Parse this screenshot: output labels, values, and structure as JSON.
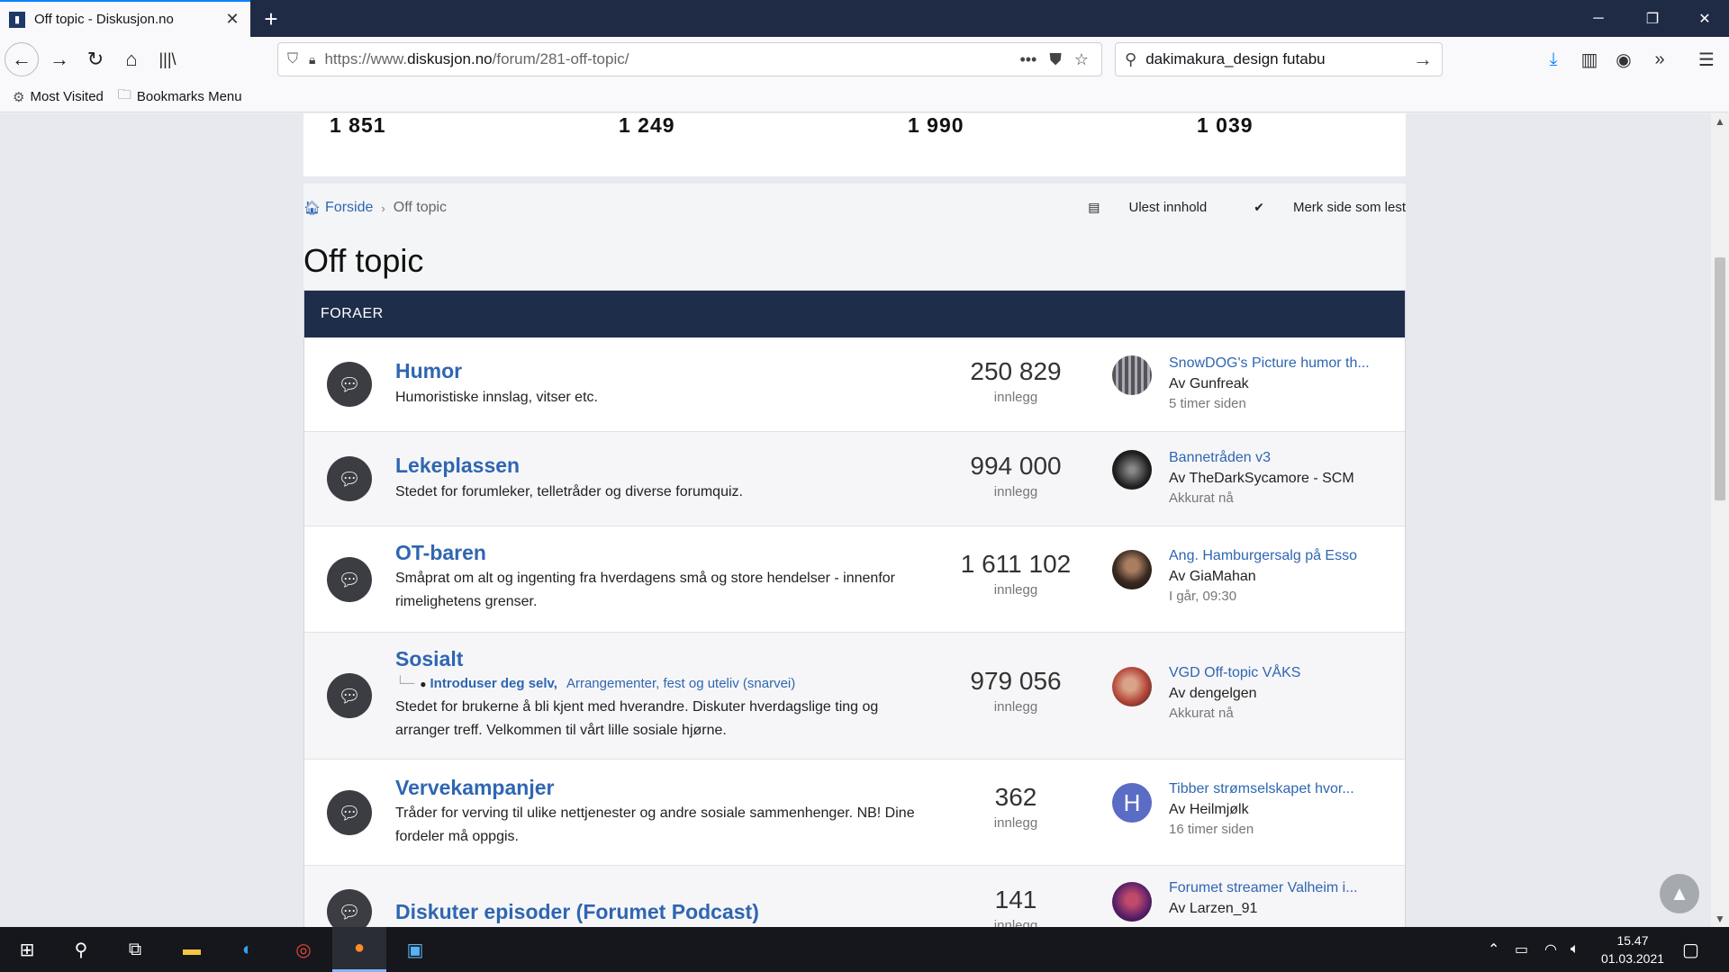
{
  "browser": {
    "tab_title": "Off topic - Diskusjon.no",
    "url_prefix": "https://www.",
    "url_domain": "diskusjon.no",
    "url_path": "/forum/281-off-topic/",
    "search_query": "dakimakura_design futabu",
    "bookmarks": [
      {
        "label": "Most Visited",
        "icon": "gear-icon"
      },
      {
        "label": "Bookmarks Menu",
        "icon": "folder-icon"
      }
    ]
  },
  "stats": [
    "1 851",
    "1 249",
    "1 990",
    "1 039"
  ],
  "breadcrumb": {
    "home": "Forside",
    "current": "Off topic"
  },
  "actions": {
    "unread": "Ulest innhold",
    "mark_read": "Merk side som lest"
  },
  "page_title": "Off topic",
  "forum_header": "FORAER",
  "forums": [
    {
      "name": "Humor",
      "desc": "Humoristiske innslag, vitser etc.",
      "count": "250 829",
      "count_label": "innlegg",
      "last_title": "SnowDOG's Picture humor th...",
      "last_by": "Av Gunfreak",
      "last_date": "5 timer siden"
    },
    {
      "name": "Lekeplassen",
      "desc": "Stedet for forumleker, telletråder og diverse forumquiz.",
      "count": "994 000",
      "count_label": "innlegg",
      "last_title": "Bannetråden v3",
      "last_by": "Av TheDarkSycamore - SCM",
      "last_date": "Akkurat nå"
    },
    {
      "name": "OT-baren",
      "desc": "Småprat om alt og ingenting fra hverdagens små og store hendelser - innenfor rimelighetens grenser.",
      "count": "1 611 102",
      "count_label": "innlegg",
      "last_title": "Ang. Hamburgersalg på Esso",
      "last_by": "Av GiaMahan",
      "last_date": "I går, 09:30"
    },
    {
      "name": "Sosialt",
      "sub_first": "Introduser deg selv,",
      "sub_second": "Arrangementer, fest og uteliv (snarvei)",
      "desc": "Stedet for brukerne å bli kjent med hverandre. Diskuter hverdagslige ting og arranger treff. Velkommen til vårt lille sosiale hjørne.",
      "count": "979 056",
      "count_label": "innlegg",
      "last_title": "VGD Off-topic VÅKS",
      "last_by": "Av dengelgen",
      "last_date": "Akkurat nå"
    },
    {
      "name": "Vervekampanjer",
      "desc": "Tråder for verving til ulike nettjenester og andre sosiale sammenhenger. NB! Dine fordeler må oppgis.",
      "count": "362",
      "count_label": "innlegg",
      "last_title": "Tibber strømselskapet hvor...",
      "last_by": "Av Heilmjølk",
      "last_date": "16 timer siden",
      "avatar_letter": "H"
    },
    {
      "name": "Diskuter episoder (Forumet Podcast)",
      "count": "141",
      "count_label": "innlegg",
      "last_title": "Forumet streamer Valheim i...",
      "last_by": "Av Larzen_91"
    }
  ],
  "clock": {
    "time": "15.47",
    "date": "01.03.2021"
  }
}
